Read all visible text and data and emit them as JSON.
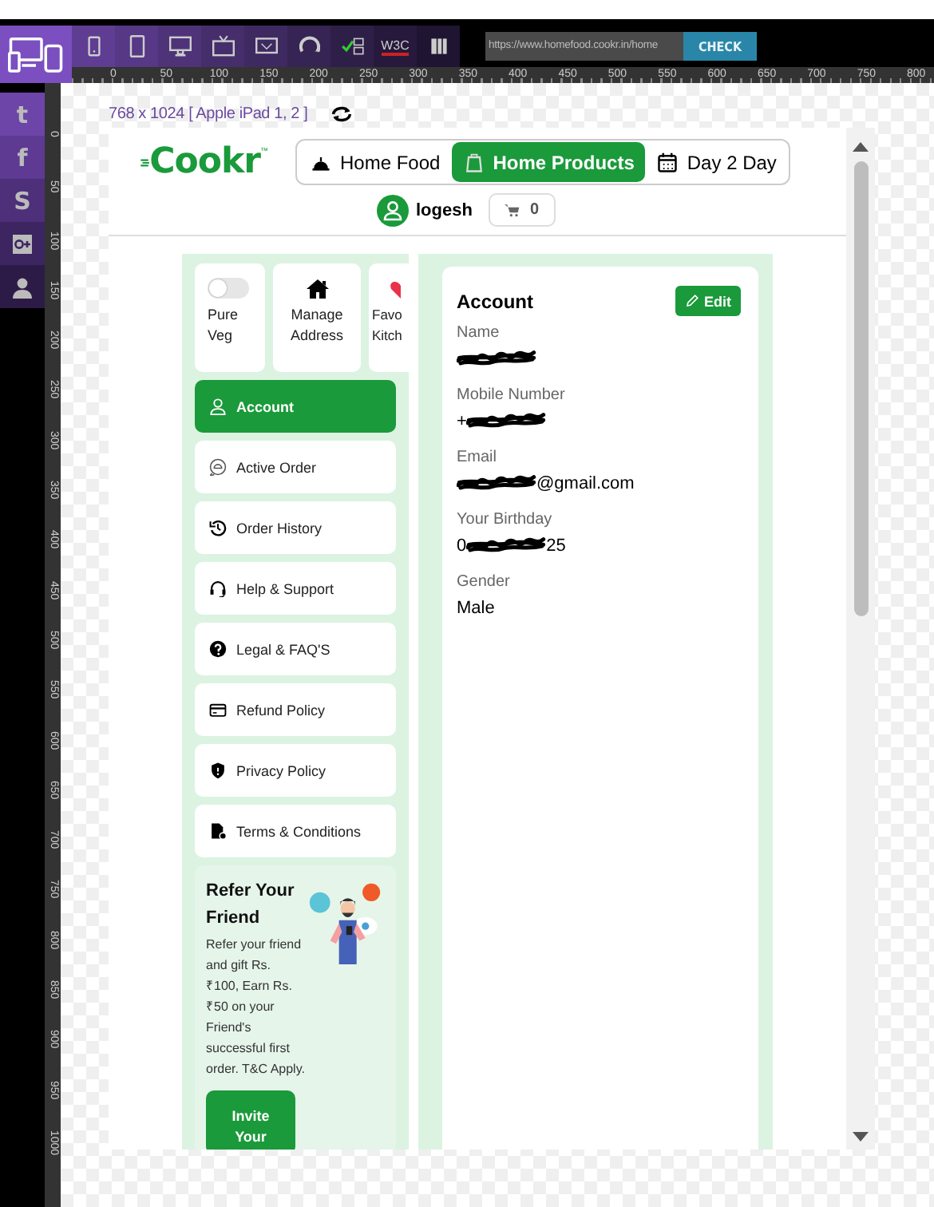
{
  "toolbar": {
    "tools": [
      {
        "kind": "phone"
      },
      {
        "kind": "tablet"
      },
      {
        "kind": "monitor"
      },
      {
        "kind": "tv"
      },
      {
        "kind": "screen"
      },
      {
        "kind": "rotate"
      },
      {
        "kind": "validate"
      },
      {
        "kind": "w3c",
        "label": "W3C"
      },
      {
        "kind": "book"
      }
    ],
    "url": "https://www.homefood.cookr.in/home",
    "check": "CHECK"
  },
  "ruler": {
    "x_labels": [
      "0",
      "50",
      "100",
      "150",
      "200",
      "250",
      "300",
      "350",
      "400",
      "450",
      "500",
      "550",
      "600",
      "650",
      "700",
      "750",
      "800"
    ],
    "y_labels": [
      "0",
      "50",
      "100",
      "150",
      "200",
      "250",
      "300",
      "350",
      "400",
      "450",
      "500",
      "550",
      "600",
      "650",
      "700",
      "750",
      "800",
      "850",
      "900",
      "950",
      "1000"
    ]
  },
  "social": [
    {
      "kind": "glyph",
      "glyph": "t"
    },
    {
      "kind": "glyph",
      "glyph": "f"
    },
    {
      "kind": "glyph",
      "glyph": "S"
    },
    {
      "kind": "gplus"
    },
    {
      "kind": "user"
    }
  ],
  "device": {
    "label": "768 x 1024 [ Apple iPad 1, 2 ]"
  },
  "site": {
    "logo": "Cookr",
    "logo_mark": "™",
    "nav": [
      {
        "kind": "dish",
        "label": "Home Food",
        "selected": false
      },
      {
        "kind": "bag",
        "label": "Home Products",
        "selected": true
      },
      {
        "kind": "calendar",
        "label": "Day 2 Day",
        "selected": false
      }
    ],
    "user": "logesh",
    "cart_count": "0"
  },
  "quick_cards": [
    {
      "kind": "toggle",
      "label": "Pure Veg",
      "on": false
    },
    {
      "kind": "home",
      "label": "Manage Address"
    },
    {
      "kind": "heart",
      "label": "Favo Kitch"
    }
  ],
  "menu": [
    {
      "kind": "user",
      "label": "Account",
      "selected": true
    },
    {
      "kind": "chat",
      "label": "Active Order",
      "selected": false
    },
    {
      "kind": "history",
      "label": "Order History",
      "selected": false
    },
    {
      "kind": "headset",
      "label": "Help & Support",
      "selected": false
    },
    {
      "kind": "question",
      "label": "Legal & FAQ'S",
      "selected": false
    },
    {
      "kind": "card",
      "label": "Refund Policy",
      "selected": false
    },
    {
      "kind": "shield",
      "label": "Privacy Policy",
      "selected": false
    },
    {
      "kind": "doc",
      "label": "Terms & Conditions",
      "selected": false
    }
  ],
  "refer": {
    "title": "Refer Your Friend",
    "text": "Refer your friend and gift Rs. ₹100, Earn Rs. ₹50 on your Friend's successful first order. T&C Apply.",
    "button": "Invite Your"
  },
  "account": {
    "title": "Account",
    "edit": "Edit",
    "fields": [
      {
        "label": "Name",
        "parts": [
          {
            "kind": "scribble"
          }
        ]
      },
      {
        "label": "Mobile Number",
        "parts": [
          {
            "kind": "text",
            "text": "+"
          },
          {
            "kind": "scribble"
          }
        ]
      },
      {
        "label": "Email",
        "parts": [
          {
            "kind": "scribble"
          },
          {
            "kind": "text",
            "text": "@gmail.com"
          }
        ]
      },
      {
        "label": "Your Birthday",
        "parts": [
          {
            "kind": "text",
            "text": "0"
          },
          {
            "kind": "scribble"
          },
          {
            "kind": "text",
            "text": "25"
          }
        ]
      },
      {
        "label": "Gender",
        "parts": [
          {
            "kind": "text",
            "text": "Male"
          }
        ]
      }
    ]
  }
}
